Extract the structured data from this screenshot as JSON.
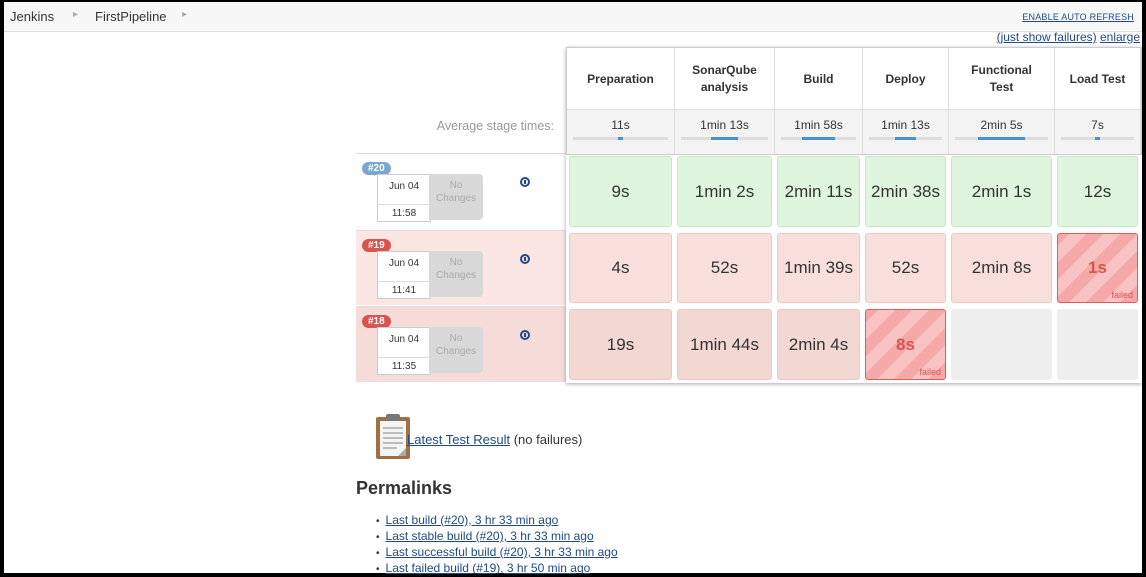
{
  "breadcrumb": [
    "Jenkins",
    "FirstPipeline"
  ],
  "header": {
    "auto_refresh": "ENABLE AUTO REFRESH",
    "just_show_failures": "(just show failures)",
    "enlarge": "enlarge"
  },
  "stages": [
    {
      "name": "Preparation",
      "avg": "11s",
      "avg_fraction": 0.1
    },
    {
      "name": "SonarQube analysis",
      "avg": "1min 13s",
      "avg_fraction": 0.6
    },
    {
      "name": "Build",
      "avg": "1min 58s",
      "avg_fraction": 0.9
    },
    {
      "name": "Deploy",
      "avg": "1min 13s",
      "avg_fraction": 0.6
    },
    {
      "name": "Functional Test",
      "avg": "2min 5s",
      "avg_fraction": 1.0
    },
    {
      "name": "Load Test",
      "avg": "7s",
      "avg_fraction": 0.06
    }
  ],
  "avg_label": "Average stage times:",
  "builds": [
    {
      "number": "#20",
      "status": "success",
      "date": "Jun 04",
      "time": "11:58",
      "changes": "No Changes",
      "stages": [
        {
          "value": "9s",
          "status": "success"
        },
        {
          "value": "1min 2s",
          "status": "success"
        },
        {
          "value": "2min 11s",
          "status": "success"
        },
        {
          "value": "2min 38s",
          "status": "success"
        },
        {
          "value": "2min 1s",
          "status": "success"
        },
        {
          "value": "12s",
          "status": "success"
        }
      ]
    },
    {
      "number": "#19",
      "status": "failed",
      "date": "Jun 04",
      "time": "11:41",
      "changes": "No Changes",
      "stages": [
        {
          "value": "4s",
          "status": "success"
        },
        {
          "value": "52s",
          "status": "success"
        },
        {
          "value": "1min 39s",
          "status": "success"
        },
        {
          "value": "52s",
          "status": "success"
        },
        {
          "value": "2min 8s",
          "status": "success"
        },
        {
          "value": "1s",
          "status": "failed",
          "label": "failed"
        }
      ]
    },
    {
      "number": "#18",
      "status": "failed",
      "date": "Jun 04",
      "time": "11:35",
      "changes": "No Changes",
      "stages": [
        {
          "value": "19s",
          "status": "success"
        },
        {
          "value": "1min 44s",
          "status": "success"
        },
        {
          "value": "2min 4s",
          "status": "success"
        },
        {
          "value": "8s",
          "status": "failed",
          "label": "failed"
        },
        {
          "value": "",
          "status": "none"
        },
        {
          "value": "",
          "status": "none"
        }
      ]
    }
  ],
  "test_result": {
    "link": "Latest Test Result",
    "suffix": "(no failures)"
  },
  "permalinks": {
    "title": "Permalinks",
    "items": [
      "Last build (#20), 3 hr 33 min ago",
      "Last stable build (#20), 3 hr 33 min ago",
      "Last successful build (#20), 3 hr 33 min ago",
      "Last failed build (#19), 3 hr 50 min ago"
    ]
  },
  "colors": {
    "badge_success": "#7ca7d0",
    "badge_failed": "#d9534f",
    "row_success_bg": "#ffffff",
    "row_failed_bg": "#fbe6e3",
    "cell_success": "#dff5dd",
    "cell_success_row_failed": "#f9dfdb",
    "cell_success_row18": "#f2d7d3",
    "cell_empty": "#eeeeee"
  }
}
